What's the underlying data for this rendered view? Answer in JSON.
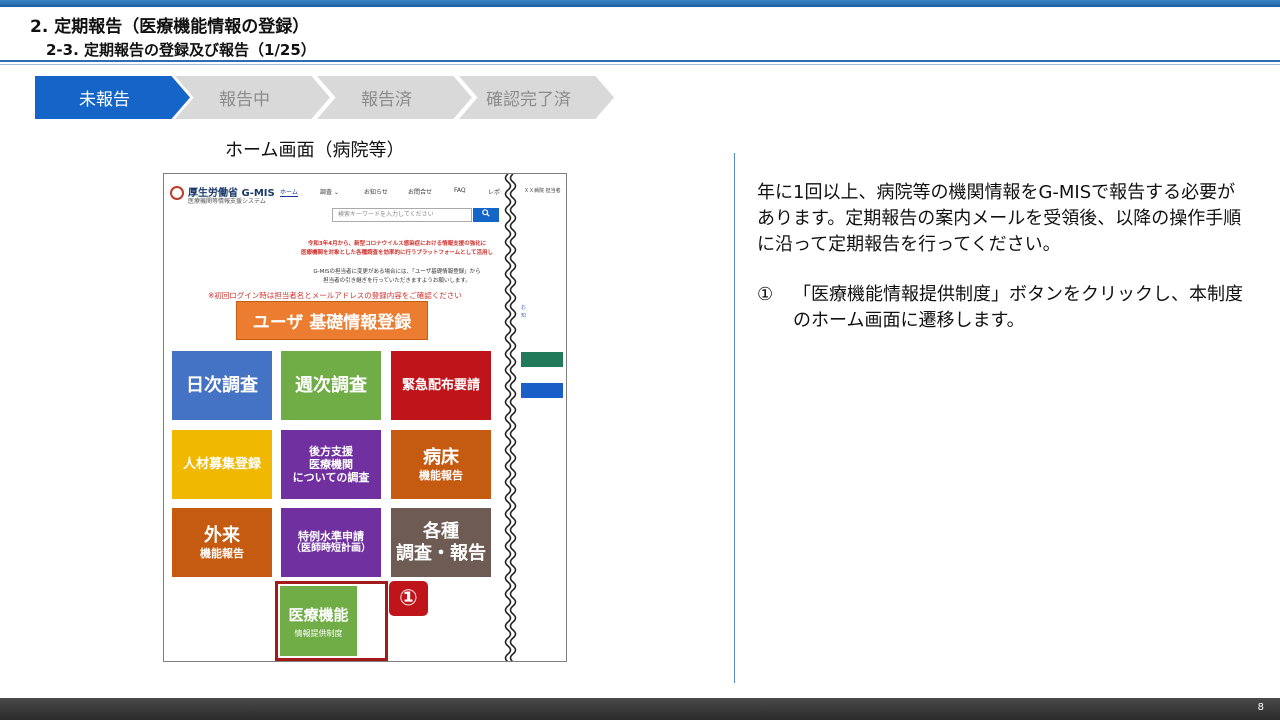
{
  "header": {
    "title": "2. 定期報告（医療機能情報の登録）",
    "subtitle": "2-3. 定期報告の登録及び報告（1/25）"
  },
  "status_steps": [
    {
      "label": "未報告",
      "active": true
    },
    {
      "label": "報告中",
      "active": false
    },
    {
      "label": "報告済",
      "active": false
    },
    {
      "label": "確認完了済",
      "active": false
    }
  ],
  "screenshot": {
    "caption": "ホーム画面（病院等）",
    "logo_name": "厚生労働省 G-MIS",
    "logo_sub": "医療機関等情報支援システム",
    "nav": [
      "ホーム",
      "調査 ⌄",
      "お知らせ",
      "お問合せ",
      "FAQ",
      "レポー"
    ],
    "user": "ＸＸ病院 担当者",
    "search_placeholder": "検索キーワードを入力してください",
    "search_button_icon": "magnifier-icon",
    "notice_red_1": "令和3年4月から、新型コロナウイルス感染症における情報支援の強化に",
    "notice_red_2": "医療機関を対象とした各種調査を効率的に行うプラットフォームとして活用し",
    "notice_black_1": "G-MISの担当者に変更がある場合には、「ユーザ基礎情報登録」から",
    "notice_black_2": "担当者の引き継ぎを行っていただきますようお願いします。",
    "login_note": "※初回ログイン時は担当者名とメールアドレスの登録内容をご確認ください",
    "register_button": "ユーザ 基礎情報登録",
    "tiles": [
      {
        "line1": "日次調査",
        "line2": "",
        "line3": "",
        "color": "#4472c4"
      },
      {
        "line1": "週次調査",
        "line2": "",
        "line3": "",
        "color": "#71ad47"
      },
      {
        "line1": "緊急配布要請",
        "line2": "",
        "line3": "",
        "color": "#c0141b"
      },
      {
        "line1": "人材募集登録",
        "line2": "",
        "line3": "",
        "color": "#f0b800"
      },
      {
        "line1": "後方支援",
        "line2": "医療機関",
        "line3": "についての調査",
        "color": "#7030a0"
      },
      {
        "line1": "病床",
        "line2": "機能報告",
        "line3": "",
        "color": "#c55a11"
      },
      {
        "line1": "外来",
        "line2": "機能報告",
        "line3": "",
        "color": "#c55a11"
      },
      {
        "line1": "特例水準申請",
        "line2": "（医師時短計画）",
        "line3": "",
        "color": "#7030a0"
      },
      {
        "line1": "各種",
        "line2": "調査・報告",
        "line3": "",
        "color": "#6d5b54"
      }
    ],
    "medical_tile": {
      "big": "医療機能",
      "small": "情報提供制度",
      "color": "#71ad47"
    },
    "side_tiny_1": "お",
    "side_tiny_2": "知",
    "side_colors": [
      "#217a5a",
      "#1a5fc8"
    ]
  },
  "badge": "①",
  "description": "年に1回以上、病院等の機関情報をG-MISで報告する必要があります。定期報告の案内メールを受領後、以降の操作手順に沿って定期報告を行ってください。",
  "instruction": {
    "num": "①",
    "text": "「医療機能情報提供制度」ボタンをクリックし、本制度のホーム画面に遷移します。"
  },
  "page_number": "8",
  "colors": {
    "accent": "#1565c8",
    "inactive_step": "#d9d9d9",
    "highlight": "#a31a1a",
    "footer": "#333333"
  }
}
